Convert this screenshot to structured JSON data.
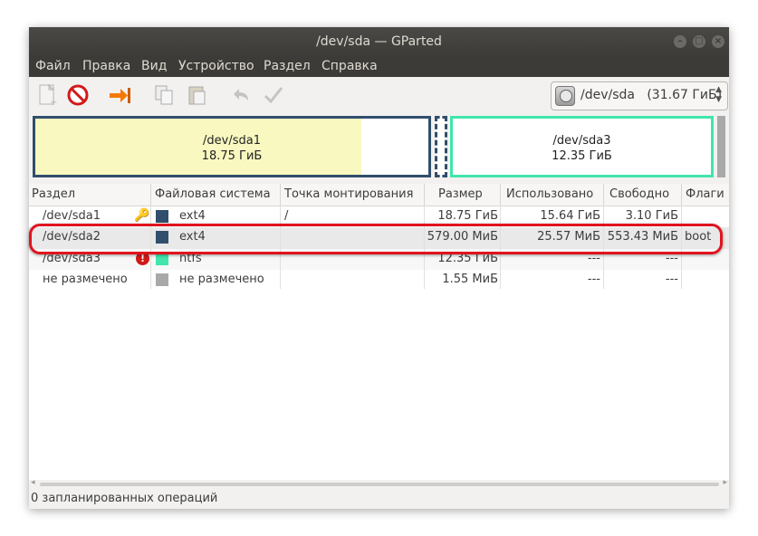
{
  "window": {
    "title": "/dev/sda — GParted",
    "controls": {
      "minimize": "–",
      "maximize": "□",
      "close": "×"
    }
  },
  "menu": [
    "Файл",
    "Правка",
    "Вид",
    "Устройство",
    "Раздел",
    "Справка"
  ],
  "toolbar": {
    "icons": [
      "new-partition-icon",
      "delete-icon",
      "resize-move-icon",
      "copy-icon",
      "paste-icon",
      "undo-icon",
      "apply-icon"
    ],
    "device": {
      "label": "/dev/sda",
      "size": "(31.67 ГиБ)"
    }
  },
  "disk_map": [
    {
      "name": "/dev/sda1",
      "size": "18.75 ГиБ",
      "used_fraction": 0.834
    },
    {
      "name": "/dev/sda2",
      "size": "",
      "used_fraction": 0.044
    },
    {
      "name": "/dev/sda3",
      "size": "12.35 ГиБ",
      "used_fraction": 0
    }
  ],
  "table": {
    "columns": [
      "Раздел",
      "Файловая система",
      "Точка монтирования",
      "Размер",
      "Использовано",
      "Свободно",
      "Флаги"
    ],
    "rows": [
      {
        "partition": "/dev/sda1",
        "fs": "ext4",
        "fs_color": "#314e6c",
        "mount": "/",
        "size": "18.75 ГиБ",
        "used": "15.64 ГиБ",
        "free": "3.10 ГиБ",
        "flags": "",
        "badge": "key-icon"
      },
      {
        "partition": "/dev/sda2",
        "fs": "ext4",
        "fs_color": "#314e6c",
        "mount": "",
        "size": "579.00 МиБ",
        "used": "25.57 МиБ",
        "free": "553.43 МиБ",
        "flags": "boot",
        "badge": ""
      },
      {
        "partition": "/dev/sda3",
        "fs": "ntfs",
        "fs_color": "#42e5ac",
        "mount": "",
        "size": "12.35 ГиБ",
        "used": "---",
        "free": "---",
        "flags": "",
        "badge": "warning-icon"
      },
      {
        "partition": "не размечено",
        "fs": "не размечено",
        "fs_color": "#a9a9a9",
        "mount": "",
        "size": "1.55 МиБ",
        "used": "---",
        "free": "---",
        "flags": "",
        "badge": ""
      }
    ]
  },
  "status": {
    "text": "0 запланированных операций"
  },
  "colors": {
    "selection_highlight": "#e0141e",
    "ext4": "#314e6c",
    "ntfs": "#42e5ac",
    "unallocated": "#a9a9a9",
    "used_fill": "#f8f8c0"
  }
}
